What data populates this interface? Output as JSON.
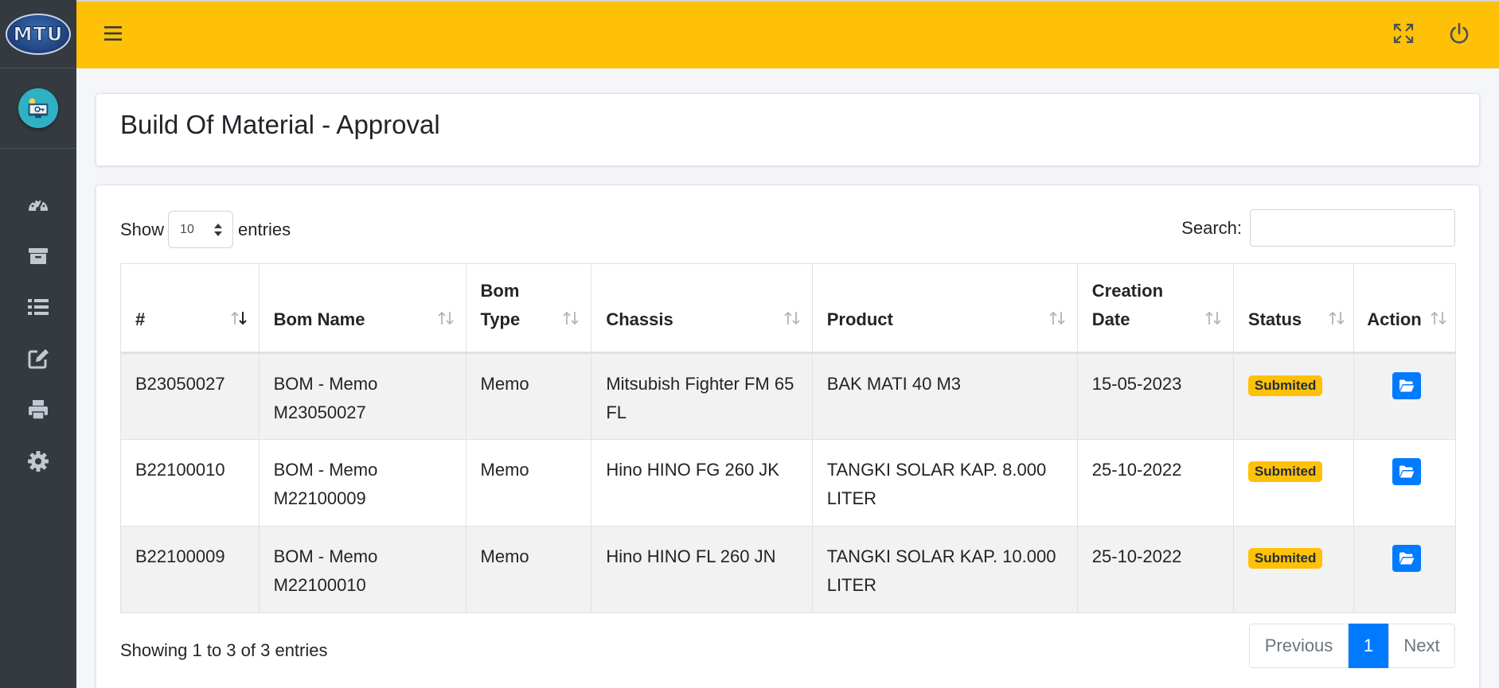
{
  "brand": {
    "logo_text": "MTU"
  },
  "page_title": "Build Of Material - Approval",
  "table_controls": {
    "show_label": "Show",
    "entries_label": "entries",
    "page_length": "10",
    "search_label": "Search:",
    "search_value": ""
  },
  "columns": [
    "#",
    "Bom Name",
    "Bom Type",
    "Chassis",
    "Product",
    "Creation Date",
    "Status",
    "Action"
  ],
  "rows": [
    {
      "id": "B23050027",
      "bom_name": "BOM - Memo M23050027",
      "bom_type": "Memo",
      "chassis": "Mitsubish Fighter FM 65 FL",
      "product": "BAK MATI 40 M3",
      "date": "15-05-2023",
      "status": "Submited"
    },
    {
      "id": "B22100010",
      "bom_name": "BOM - Memo M22100009",
      "bom_type": "Memo",
      "chassis": "Hino HINO FG 260 JK",
      "product": "TANGKI SOLAR KAP. 8.000 LITER",
      "date": "25-10-2022",
      "status": "Submited"
    },
    {
      "id": "B22100009",
      "bom_name": "BOM - Memo M22100010",
      "bom_type": "Memo",
      "chassis": "Hino HINO FL 260 JN",
      "product": "TANGKI SOLAR KAP. 10.000 LITER",
      "date": "25-10-2022",
      "status": "Submited"
    }
  ],
  "info_text": "Showing 1 to 3 of 3 entries",
  "pagination": {
    "previous": "Previous",
    "current": "1",
    "next": "Next"
  },
  "sidebar_icons": [
    "dashboard-icon",
    "archive-icon",
    "list-icon",
    "edit-icon",
    "print-icon",
    "gear-icon"
  ],
  "colors": {
    "topbar": "#ffc107",
    "sidebar": "#343a40",
    "primary": "#007bff",
    "badge": "#ffc107"
  }
}
